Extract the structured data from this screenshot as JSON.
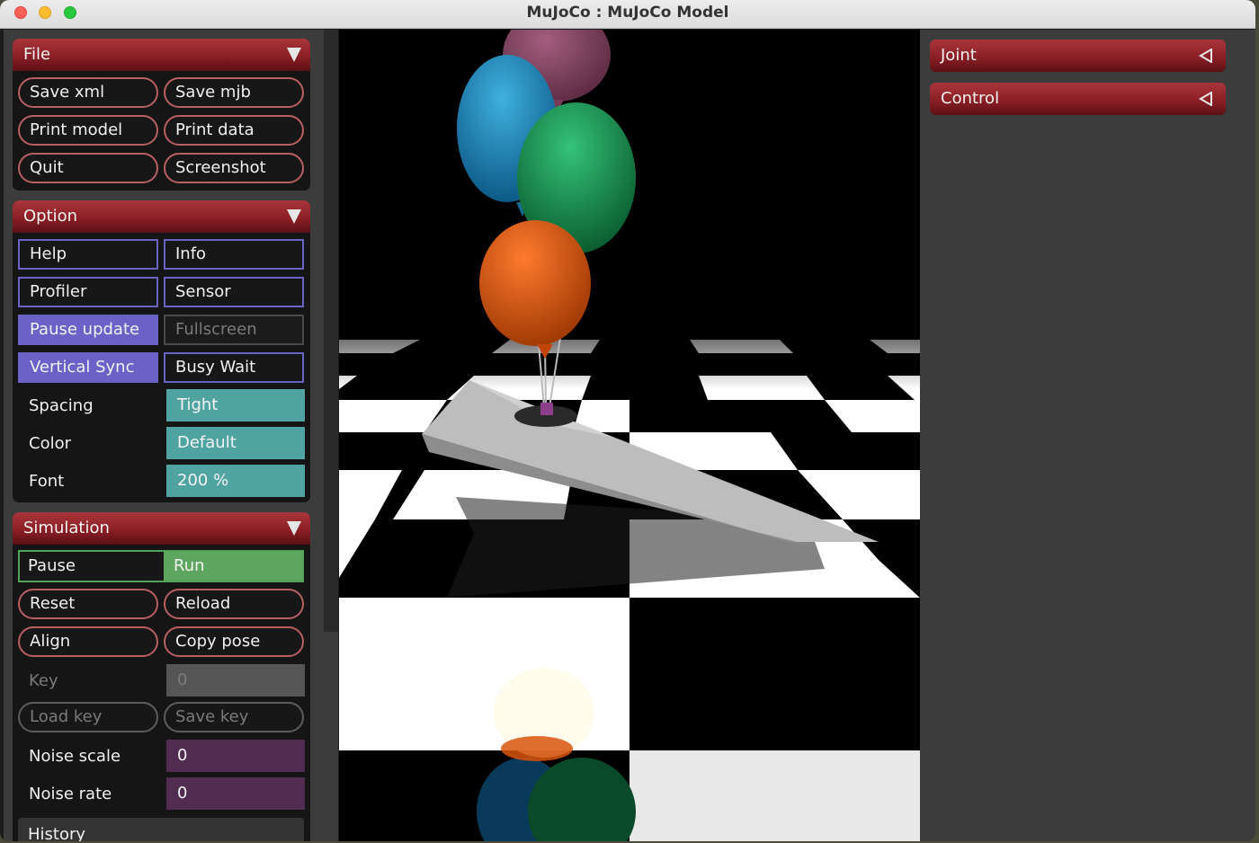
{
  "window": {
    "title": "MuJoCo : MuJoCo Model"
  },
  "left_panel": {
    "file": {
      "title": "File",
      "buttons": [
        "Save xml",
        "Save mjb",
        "Print model",
        "Print data",
        "Quit",
        "Screenshot"
      ]
    },
    "option": {
      "title": "Option",
      "toggles": [
        {
          "label": "Help",
          "checked": false
        },
        {
          "label": "Info",
          "checked": false
        },
        {
          "label": "Profiler",
          "checked": false
        },
        {
          "label": "Sensor",
          "checked": false
        },
        {
          "label": "Pause update",
          "checked": true
        },
        {
          "label": "Fullscreen",
          "checked": false,
          "disabled": true
        },
        {
          "label": "Vertical Sync",
          "checked": true
        },
        {
          "label": "Busy Wait",
          "checked": false
        }
      ],
      "spacing_label": "Spacing",
      "spacing_value": "Tight",
      "color_label": "Color",
      "color_value": "Default",
      "font_label": "Font",
      "font_value": "200 %"
    },
    "simulation": {
      "title": "Simulation",
      "pause_label": "Pause",
      "run_label": "Run",
      "selected": "Run",
      "reset_label": "Reset",
      "reload_label": "Reload",
      "align_label": "Align",
      "copy_pose_label": "Copy pose",
      "key_label": "Key",
      "key_value": "0",
      "load_key_label": "Load key",
      "save_key_label": "Save key",
      "noise_scale_label": "Noise scale",
      "noise_scale_value": "0",
      "noise_rate_label": "Noise rate",
      "noise_rate_value": "0",
      "history_label": "History"
    }
  },
  "right_panel": {
    "joint_title": "Joint",
    "control_title": "Control"
  },
  "colors": {
    "section_header": "#8b1f25",
    "checkbox_on": "#6a62c6",
    "teal_select": "#4fa3a0",
    "purple_input": "#4f2c50",
    "run_green": "#5ea55f",
    "balloon_pink": "#7a3d58",
    "balloon_blue": "#1f7fb0",
    "balloon_green": "#16884a",
    "balloon_orange": "#d9540c"
  }
}
